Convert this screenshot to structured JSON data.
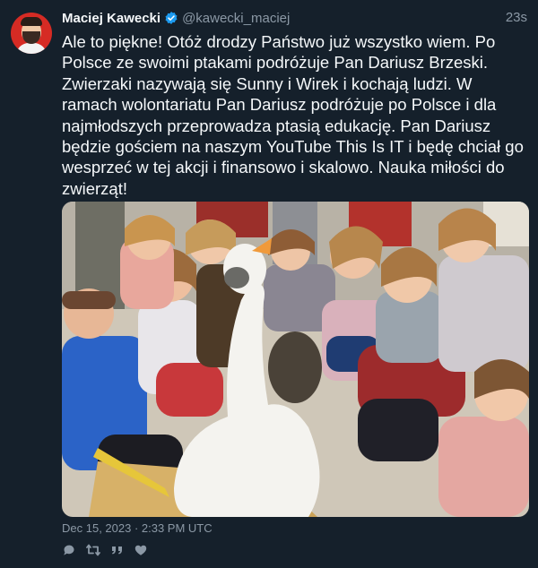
{
  "author": {
    "display_name": "Maciej Kawecki",
    "handle": "@kawecki_maciej",
    "verified": true
  },
  "tweet": {
    "relative_time": "23s",
    "text": "Ale to piękne! Otóż drodzy Państwo już wszystko wiem. Po Polsce ze swoimi ptakami podróżuje Pan Dariusz Brzeski. Zwierzaki nazywają się Sunny i Wirek i kochają ludzi. W ramach wolontariatu Pan Dariusz podróżuje po Polsce i dla najmłodszych przeprowadza ptasią edukację. Pan Dariusz będzie gościem na naszym YouTube This Is IT i będę chciał go wesprzeć w tej akcji i finansowo i skalowo. Nauka miłości do zwierząt!",
    "timestamp": "Dec 15, 2023 · 2:33 PM UTC"
  },
  "actions": [
    {
      "icon": "reply-icon"
    },
    {
      "icon": "retweet-icon"
    },
    {
      "icon": "quote-icon"
    },
    {
      "icon": "like-icon"
    }
  ],
  "colors": {
    "background": "#15202b",
    "text": "#f5f8fa",
    "muted": "#8b98a5",
    "verified": "#1d9bf0"
  }
}
